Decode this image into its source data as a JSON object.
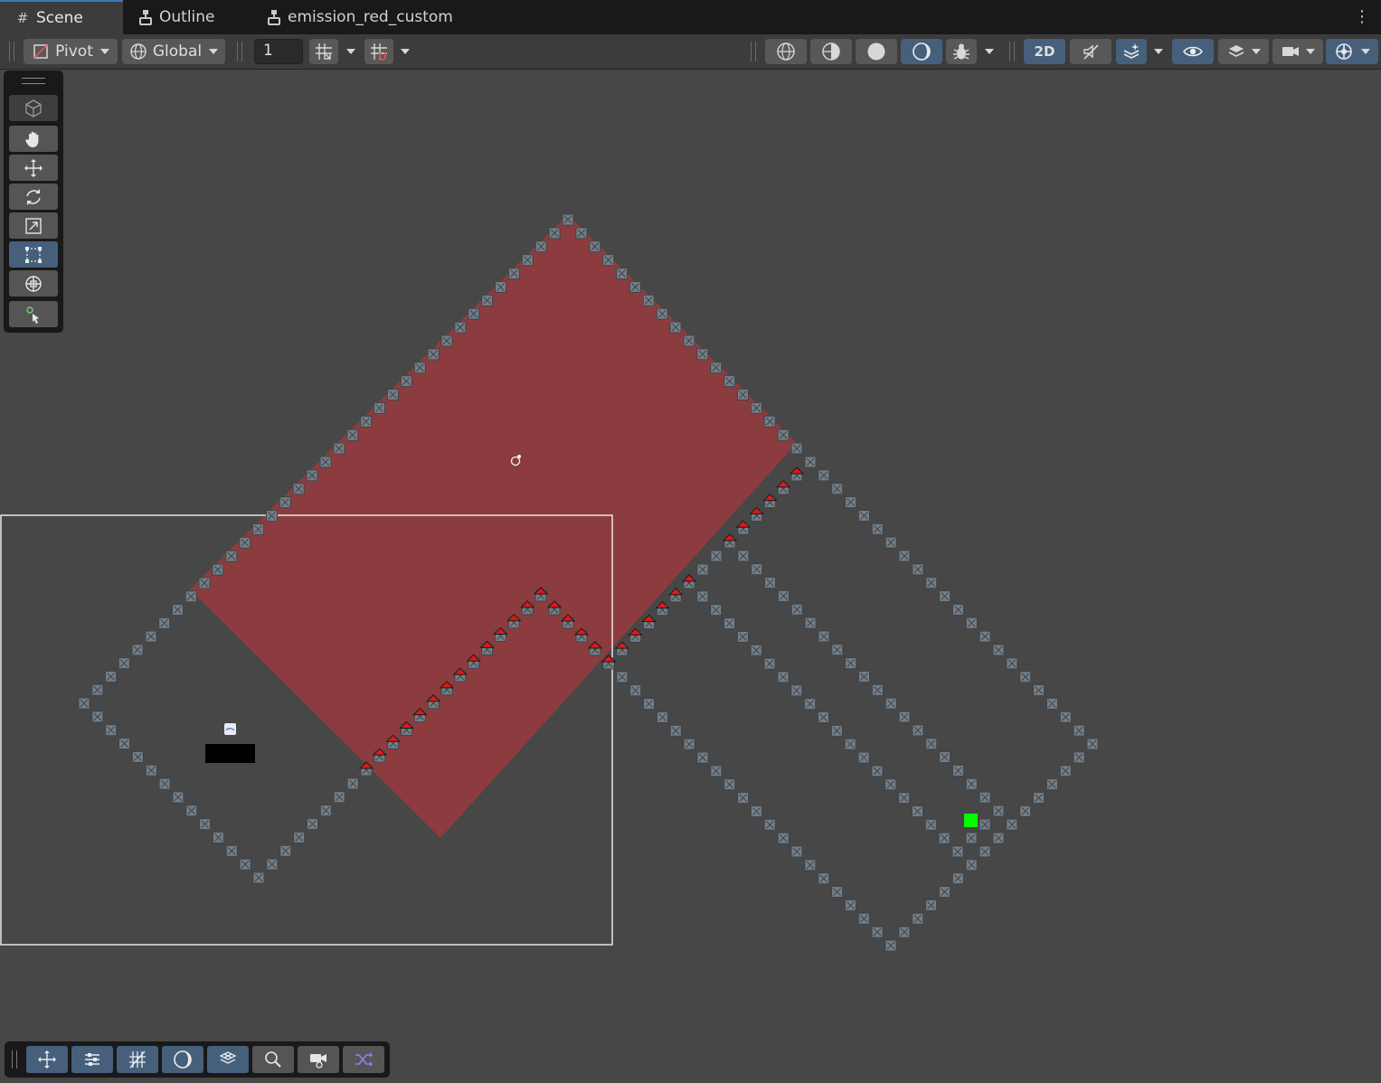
{
  "tabs": [
    {
      "label": "Scene",
      "icon": "hash-icon"
    },
    {
      "label": "Outline",
      "icon": "tree-icon"
    },
    {
      "label": "emission_red_custom",
      "icon": "tree-icon"
    }
  ],
  "toolbar": {
    "pivot_label": "Pivot",
    "space_label": "Global",
    "grid_size_value": "1",
    "mode_2d_label": "2D"
  },
  "tools": [
    {
      "name": "view-cube-icon"
    },
    {
      "name": "hand-tool-icon"
    },
    {
      "name": "move-tool-icon"
    },
    {
      "name": "rotate-tool-icon"
    },
    {
      "name": "scale-tool-icon"
    },
    {
      "name": "rect-tool-icon"
    },
    {
      "name": "transform-tool-icon"
    },
    {
      "name": "custom-tool-icon"
    }
  ],
  "colors": {
    "scene_bg": "#474747",
    "active_blue": "#46607c",
    "red_area": "#8c3c3e",
    "tile_grey": "#747e86",
    "marker_green": "#00ff00"
  }
}
